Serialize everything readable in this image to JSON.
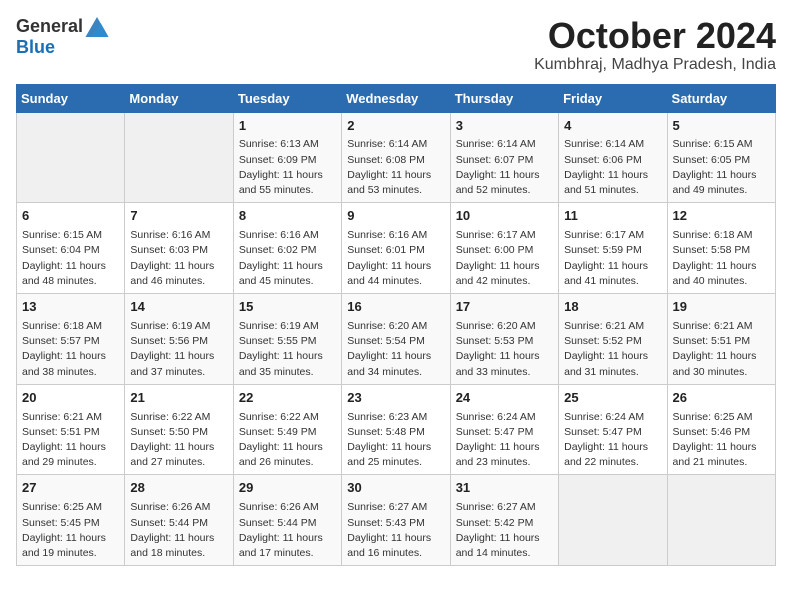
{
  "header": {
    "logo_general": "General",
    "logo_blue": "Blue",
    "month_year": "October 2024",
    "location": "Kumbhraj, Madhya Pradesh, India"
  },
  "days_of_week": [
    "Sunday",
    "Monday",
    "Tuesday",
    "Wednesday",
    "Thursday",
    "Friday",
    "Saturday"
  ],
  "weeks": [
    [
      {
        "day": "",
        "sunrise": "",
        "sunset": "",
        "daylight": ""
      },
      {
        "day": "",
        "sunrise": "",
        "sunset": "",
        "daylight": ""
      },
      {
        "day": "1",
        "sunrise": "Sunrise: 6:13 AM",
        "sunset": "Sunset: 6:09 PM",
        "daylight": "Daylight: 11 hours and 55 minutes."
      },
      {
        "day": "2",
        "sunrise": "Sunrise: 6:14 AM",
        "sunset": "Sunset: 6:08 PM",
        "daylight": "Daylight: 11 hours and 53 minutes."
      },
      {
        "day": "3",
        "sunrise": "Sunrise: 6:14 AM",
        "sunset": "Sunset: 6:07 PM",
        "daylight": "Daylight: 11 hours and 52 minutes."
      },
      {
        "day": "4",
        "sunrise": "Sunrise: 6:14 AM",
        "sunset": "Sunset: 6:06 PM",
        "daylight": "Daylight: 11 hours and 51 minutes."
      },
      {
        "day": "5",
        "sunrise": "Sunrise: 6:15 AM",
        "sunset": "Sunset: 6:05 PM",
        "daylight": "Daylight: 11 hours and 49 minutes."
      }
    ],
    [
      {
        "day": "6",
        "sunrise": "Sunrise: 6:15 AM",
        "sunset": "Sunset: 6:04 PM",
        "daylight": "Daylight: 11 hours and 48 minutes."
      },
      {
        "day": "7",
        "sunrise": "Sunrise: 6:16 AM",
        "sunset": "Sunset: 6:03 PM",
        "daylight": "Daylight: 11 hours and 46 minutes."
      },
      {
        "day": "8",
        "sunrise": "Sunrise: 6:16 AM",
        "sunset": "Sunset: 6:02 PM",
        "daylight": "Daylight: 11 hours and 45 minutes."
      },
      {
        "day": "9",
        "sunrise": "Sunrise: 6:16 AM",
        "sunset": "Sunset: 6:01 PM",
        "daylight": "Daylight: 11 hours and 44 minutes."
      },
      {
        "day": "10",
        "sunrise": "Sunrise: 6:17 AM",
        "sunset": "Sunset: 6:00 PM",
        "daylight": "Daylight: 11 hours and 42 minutes."
      },
      {
        "day": "11",
        "sunrise": "Sunrise: 6:17 AM",
        "sunset": "Sunset: 5:59 PM",
        "daylight": "Daylight: 11 hours and 41 minutes."
      },
      {
        "day": "12",
        "sunrise": "Sunrise: 6:18 AM",
        "sunset": "Sunset: 5:58 PM",
        "daylight": "Daylight: 11 hours and 40 minutes."
      }
    ],
    [
      {
        "day": "13",
        "sunrise": "Sunrise: 6:18 AM",
        "sunset": "Sunset: 5:57 PM",
        "daylight": "Daylight: 11 hours and 38 minutes."
      },
      {
        "day": "14",
        "sunrise": "Sunrise: 6:19 AM",
        "sunset": "Sunset: 5:56 PM",
        "daylight": "Daylight: 11 hours and 37 minutes."
      },
      {
        "day": "15",
        "sunrise": "Sunrise: 6:19 AM",
        "sunset": "Sunset: 5:55 PM",
        "daylight": "Daylight: 11 hours and 35 minutes."
      },
      {
        "day": "16",
        "sunrise": "Sunrise: 6:20 AM",
        "sunset": "Sunset: 5:54 PM",
        "daylight": "Daylight: 11 hours and 34 minutes."
      },
      {
        "day": "17",
        "sunrise": "Sunrise: 6:20 AM",
        "sunset": "Sunset: 5:53 PM",
        "daylight": "Daylight: 11 hours and 33 minutes."
      },
      {
        "day": "18",
        "sunrise": "Sunrise: 6:21 AM",
        "sunset": "Sunset: 5:52 PM",
        "daylight": "Daylight: 11 hours and 31 minutes."
      },
      {
        "day": "19",
        "sunrise": "Sunrise: 6:21 AM",
        "sunset": "Sunset: 5:51 PM",
        "daylight": "Daylight: 11 hours and 30 minutes."
      }
    ],
    [
      {
        "day": "20",
        "sunrise": "Sunrise: 6:21 AM",
        "sunset": "Sunset: 5:51 PM",
        "daylight": "Daylight: 11 hours and 29 minutes."
      },
      {
        "day": "21",
        "sunrise": "Sunrise: 6:22 AM",
        "sunset": "Sunset: 5:50 PM",
        "daylight": "Daylight: 11 hours and 27 minutes."
      },
      {
        "day": "22",
        "sunrise": "Sunrise: 6:22 AM",
        "sunset": "Sunset: 5:49 PM",
        "daylight": "Daylight: 11 hours and 26 minutes."
      },
      {
        "day": "23",
        "sunrise": "Sunrise: 6:23 AM",
        "sunset": "Sunset: 5:48 PM",
        "daylight": "Daylight: 11 hours and 25 minutes."
      },
      {
        "day": "24",
        "sunrise": "Sunrise: 6:24 AM",
        "sunset": "Sunset: 5:47 PM",
        "daylight": "Daylight: 11 hours and 23 minutes."
      },
      {
        "day": "25",
        "sunrise": "Sunrise: 6:24 AM",
        "sunset": "Sunset: 5:47 PM",
        "daylight": "Daylight: 11 hours and 22 minutes."
      },
      {
        "day": "26",
        "sunrise": "Sunrise: 6:25 AM",
        "sunset": "Sunset: 5:46 PM",
        "daylight": "Daylight: 11 hours and 21 minutes."
      }
    ],
    [
      {
        "day": "27",
        "sunrise": "Sunrise: 6:25 AM",
        "sunset": "Sunset: 5:45 PM",
        "daylight": "Daylight: 11 hours and 19 minutes."
      },
      {
        "day": "28",
        "sunrise": "Sunrise: 6:26 AM",
        "sunset": "Sunset: 5:44 PM",
        "daylight": "Daylight: 11 hours and 18 minutes."
      },
      {
        "day": "29",
        "sunrise": "Sunrise: 6:26 AM",
        "sunset": "Sunset: 5:44 PM",
        "daylight": "Daylight: 11 hours and 17 minutes."
      },
      {
        "day": "30",
        "sunrise": "Sunrise: 6:27 AM",
        "sunset": "Sunset: 5:43 PM",
        "daylight": "Daylight: 11 hours and 16 minutes."
      },
      {
        "day": "31",
        "sunrise": "Sunrise: 6:27 AM",
        "sunset": "Sunset: 5:42 PM",
        "daylight": "Daylight: 11 hours and 14 minutes."
      },
      {
        "day": "",
        "sunrise": "",
        "sunset": "",
        "daylight": ""
      },
      {
        "day": "",
        "sunrise": "",
        "sunset": "",
        "daylight": ""
      }
    ]
  ]
}
